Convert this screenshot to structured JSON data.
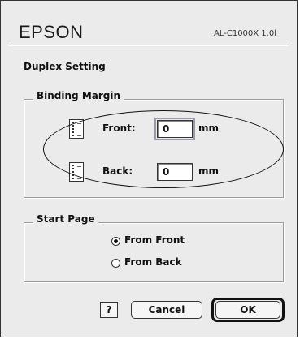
{
  "header": {
    "brand": "EPSON",
    "model": "AL-C1000X 1.0l"
  },
  "dialog_title": "Duplex Setting",
  "binding_margin": {
    "legend": "Binding Margin",
    "front": {
      "label": "Front:",
      "value": "0",
      "unit": "mm"
    },
    "back": {
      "label": "Back:",
      "value": "0",
      "unit": "mm"
    }
  },
  "start_page": {
    "legend": "Start Page",
    "options": [
      {
        "label": "From Front",
        "selected": true
      },
      {
        "label": "From Back",
        "selected": false
      }
    ]
  },
  "buttons": {
    "help": "?",
    "cancel": "Cancel",
    "ok": "OK"
  }
}
